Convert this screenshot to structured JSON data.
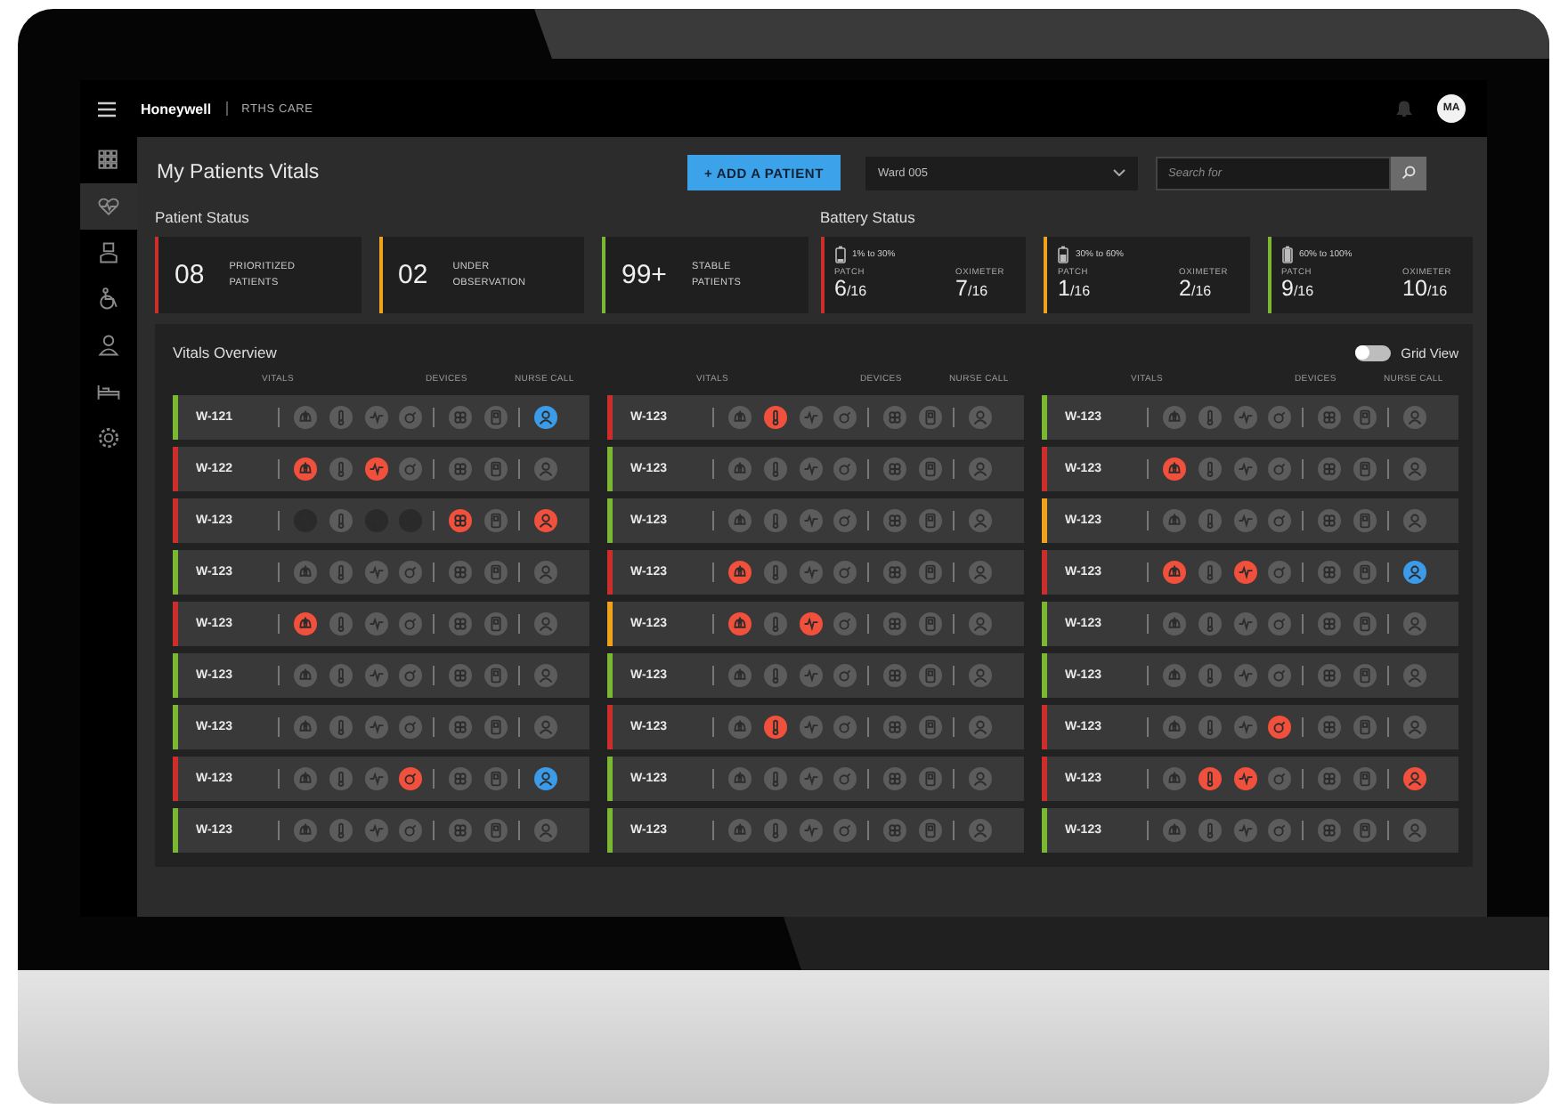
{
  "topbar": {
    "brand": "Honeywell",
    "product": "RTHS CARE",
    "avatar": "MA"
  },
  "sidebar": {
    "items": [
      {
        "kind": "grid",
        "selected": false
      },
      {
        "kind": "heart",
        "selected": true
      },
      {
        "kind": "nurse",
        "selected": false
      },
      {
        "kind": "wheelchair",
        "selected": false
      },
      {
        "kind": "doctor",
        "selected": false
      },
      {
        "kind": "bed",
        "selected": false
      },
      {
        "kind": "settings",
        "selected": false
      }
    ]
  },
  "page_title": "My Patients Vitals",
  "add_button": "+ ADD A PATIENT",
  "ward_select": {
    "value": "Ward 005"
  },
  "search": {
    "placeholder": "Search for"
  },
  "patient_status": {
    "title": "Patient Status",
    "cards": [
      {
        "count": "08",
        "label": "PRIORITIZED PATIENTS",
        "color": "#cc2e2b"
      },
      {
        "count": "02",
        "label": "UNDER OBSERVATION",
        "color": "#f0a21c"
      },
      {
        "count": "99+",
        "label": "STABLE PATIENTS",
        "color": "#7ab733"
      }
    ]
  },
  "battery_status": {
    "title": "Battery Status",
    "cards": [
      {
        "kind": "low",
        "range": "1% to 30%",
        "color": "#cc2e2b",
        "patch_label": "PATCH",
        "patch": "6",
        "patch_total": "/16",
        "oximeter_label": "OXIMETER",
        "oximeter": "7",
        "oximeter_total": "/16"
      },
      {
        "kind": "mid",
        "range": "30% to 60%",
        "color": "#f0a21c",
        "patch_label": "PATCH",
        "patch": "1",
        "patch_total": "/16",
        "oximeter_label": "OXIMETER",
        "oximeter": "2",
        "oximeter_total": "/16"
      },
      {
        "kind": "high",
        "range": "60% to 100%",
        "color": "#7ab733",
        "patch_label": "PATCH",
        "patch": "9",
        "patch_total": "/16",
        "oximeter_label": "OXIMETER",
        "oximeter": "10",
        "oximeter_total": "/16"
      }
    ]
  },
  "overview": {
    "title": "Vitals Overview",
    "grid_view": {
      "label": "Grid View",
      "on": false
    },
    "columns": [
      {
        "headers": [
          "VITALS",
          "DEVICES",
          "NURSE CALL"
        ],
        "rows": [
          {
            "ward": "W-121",
            "color": "#7ab733",
            "vitals": [
              {
                "color": "#5c5c5c"
              },
              {
                "color": "#5c5c5c"
              },
              {
                "color": "#5c5c5c"
              },
              {
                "color": "#5c5c5c"
              }
            ],
            "devices": [
              {
                "color": "#5c5c5c"
              },
              {
                "color": "#5c5c5c"
              }
            ],
            "nurse_call": {
              "color": "#3c9be8"
            }
          },
          {
            "ward": "W-122",
            "color": "#cc2e2b",
            "vitals": [
              {
                "color": "#f0503c"
              },
              {
                "color": "#5c5c5c"
              },
              {
                "color": "#f0503c"
              },
              {
                "color": "#5c5c5c"
              }
            ],
            "devices": [
              {
                "color": "#5c5c5c"
              },
              {
                "color": "#5c5c5c"
              }
            ],
            "nurse_call": {
              "color": "#5c5c5c"
            }
          },
          {
            "ward": "W-123",
            "color": "#cc2e2b",
            "vitals": [
              {
                "color": "#2a2a2a"
              },
              {
                "color": "#5c5c5c"
              },
              {
                "color": "#2a2a2a"
              },
              {
                "color": "#2a2a2a"
              }
            ],
            "devices": [
              {
                "color": "#f0503c"
              },
              {
                "color": "#5c5c5c"
              }
            ],
            "nurse_call": {
              "color": "#f0503c"
            }
          },
          {
            "ward": "W-123",
            "color": "#7ab733",
            "vitals": [
              {
                "color": "#5c5c5c"
              },
              {
                "color": "#5c5c5c"
              },
              {
                "color": "#5c5c5c"
              },
              {
                "color": "#5c5c5c"
              }
            ],
            "devices": [
              {
                "color": "#5c5c5c"
              },
              {
                "color": "#5c5c5c"
              }
            ],
            "nurse_call": {
              "color": "#5c5c5c"
            }
          },
          {
            "ward": "W-123",
            "color": "#cc2e2b",
            "vitals": [
              {
                "color": "#f0503c"
              },
              {
                "color": "#5c5c5c"
              },
              {
                "color": "#5c5c5c"
              },
              {
                "color": "#5c5c5c"
              }
            ],
            "devices": [
              {
                "color": "#5c5c5c"
              },
              {
                "color": "#5c5c5c"
              }
            ],
            "nurse_call": {
              "color": "#5c5c5c"
            }
          },
          {
            "ward": "W-123",
            "color": "#7ab733",
            "vitals": [
              {
                "color": "#5c5c5c"
              },
              {
                "color": "#5c5c5c"
              },
              {
                "color": "#5c5c5c"
              },
              {
                "color": "#5c5c5c"
              }
            ],
            "devices": [
              {
                "color": "#5c5c5c"
              },
              {
                "color": "#5c5c5c"
              }
            ],
            "nurse_call": {
              "color": "#5c5c5c"
            }
          },
          {
            "ward": "W-123",
            "color": "#7ab733",
            "vitals": [
              {
                "color": "#5c5c5c"
              },
              {
                "color": "#5c5c5c"
              },
              {
                "color": "#5c5c5c"
              },
              {
                "color": "#5c5c5c"
              }
            ],
            "devices": [
              {
                "color": "#5c5c5c"
              },
              {
                "color": "#5c5c5c"
              }
            ],
            "nurse_call": {
              "color": "#5c5c5c"
            }
          },
          {
            "ward": "W-123",
            "color": "#cc2e2b",
            "vitals": [
              {
                "color": "#5c5c5c"
              },
              {
                "color": "#5c5c5c"
              },
              {
                "color": "#5c5c5c"
              },
              {
                "color": "#f0503c"
              }
            ],
            "devices": [
              {
                "color": "#5c5c5c"
              },
              {
                "color": "#5c5c5c"
              }
            ],
            "nurse_call": {
              "color": "#3c9be8"
            }
          },
          {
            "ward": "W-123",
            "color": "#7ab733",
            "vitals": [
              {
                "color": "#5c5c5c"
              },
              {
                "color": "#5c5c5c"
              },
              {
                "color": "#5c5c5c"
              },
              {
                "color": "#5c5c5c"
              }
            ],
            "devices": [
              {
                "color": "#5c5c5c"
              },
              {
                "color": "#5c5c5c"
              }
            ],
            "nurse_call": {
              "color": "#5c5c5c"
            }
          }
        ]
      },
      {
        "headers": [
          "VITALS",
          "DEVICES",
          "NURSE CALL"
        ],
        "rows": [
          {
            "ward": "W-123",
            "color": "#cc2e2b",
            "vitals": [
              {
                "color": "#5c5c5c"
              },
              {
                "color": "#f0503c"
              },
              {
                "color": "#5c5c5c"
              },
              {
                "color": "#5c5c5c"
              }
            ],
            "devices": [
              {
                "color": "#5c5c5c"
              },
              {
                "color": "#5c5c5c"
              }
            ],
            "nurse_call": {
              "color": "#5c5c5c"
            }
          },
          {
            "ward": "W-123",
            "color": "#7ab733",
            "vitals": [
              {
                "color": "#5c5c5c"
              },
              {
                "color": "#5c5c5c"
              },
              {
                "color": "#5c5c5c"
              },
              {
                "color": "#5c5c5c"
              }
            ],
            "devices": [
              {
                "color": "#5c5c5c"
              },
              {
                "color": "#5c5c5c"
              }
            ],
            "nurse_call": {
              "color": "#5c5c5c"
            }
          },
          {
            "ward": "W-123",
            "color": "#7ab733",
            "vitals": [
              {
                "color": "#5c5c5c"
              },
              {
                "color": "#5c5c5c"
              },
              {
                "color": "#5c5c5c"
              },
              {
                "color": "#5c5c5c"
              }
            ],
            "devices": [
              {
                "color": "#5c5c5c"
              },
              {
                "color": "#5c5c5c"
              }
            ],
            "nurse_call": {
              "color": "#5c5c5c"
            }
          },
          {
            "ward": "W-123",
            "color": "#cc2e2b",
            "vitals": [
              {
                "color": "#f0503c"
              },
              {
                "color": "#5c5c5c"
              },
              {
                "color": "#5c5c5c"
              },
              {
                "color": "#5c5c5c"
              }
            ],
            "devices": [
              {
                "color": "#5c5c5c"
              },
              {
                "color": "#5c5c5c"
              }
            ],
            "nurse_call": {
              "color": "#5c5c5c"
            }
          },
          {
            "ward": "W-123",
            "color": "#f0a21c",
            "vitals": [
              {
                "color": "#f0503c"
              },
              {
                "color": "#5c5c5c"
              },
              {
                "color": "#f0503c"
              },
              {
                "color": "#5c5c5c"
              }
            ],
            "devices": [
              {
                "color": "#5c5c5c"
              },
              {
                "color": "#5c5c5c"
              }
            ],
            "nurse_call": {
              "color": "#5c5c5c"
            }
          },
          {
            "ward": "W-123",
            "color": "#7ab733",
            "vitals": [
              {
                "color": "#5c5c5c"
              },
              {
                "color": "#5c5c5c"
              },
              {
                "color": "#5c5c5c"
              },
              {
                "color": "#5c5c5c"
              }
            ],
            "devices": [
              {
                "color": "#5c5c5c"
              },
              {
                "color": "#5c5c5c"
              }
            ],
            "nurse_call": {
              "color": "#5c5c5c"
            }
          },
          {
            "ward": "W-123",
            "color": "#cc2e2b",
            "vitals": [
              {
                "color": "#5c5c5c"
              },
              {
                "color": "#f0503c"
              },
              {
                "color": "#5c5c5c"
              },
              {
                "color": "#5c5c5c"
              }
            ],
            "devices": [
              {
                "color": "#5c5c5c"
              },
              {
                "color": "#5c5c5c"
              }
            ],
            "nurse_call": {
              "color": "#5c5c5c"
            }
          },
          {
            "ward": "W-123",
            "color": "#7ab733",
            "vitals": [
              {
                "color": "#5c5c5c"
              },
              {
                "color": "#5c5c5c"
              },
              {
                "color": "#5c5c5c"
              },
              {
                "color": "#5c5c5c"
              }
            ],
            "devices": [
              {
                "color": "#5c5c5c"
              },
              {
                "color": "#5c5c5c"
              }
            ],
            "nurse_call": {
              "color": "#5c5c5c"
            }
          },
          {
            "ward": "W-123",
            "color": "#7ab733",
            "vitals": [
              {
                "color": "#5c5c5c"
              },
              {
                "color": "#5c5c5c"
              },
              {
                "color": "#5c5c5c"
              },
              {
                "color": "#5c5c5c"
              }
            ],
            "devices": [
              {
                "color": "#5c5c5c"
              },
              {
                "color": "#5c5c5c"
              }
            ],
            "nurse_call": {
              "color": "#5c5c5c"
            }
          }
        ]
      },
      {
        "headers": [
          "VITALS",
          "DEVICES",
          "NURSE CALL"
        ],
        "rows": [
          {
            "ward": "W-123",
            "color": "#7ab733",
            "vitals": [
              {
                "color": "#5c5c5c"
              },
              {
                "color": "#5c5c5c"
              },
              {
                "color": "#5c5c5c"
              },
              {
                "color": "#5c5c5c"
              }
            ],
            "devices": [
              {
                "color": "#5c5c5c"
              },
              {
                "color": "#5c5c5c"
              }
            ],
            "nurse_call": {
              "color": "#5c5c5c"
            }
          },
          {
            "ward": "W-123",
            "color": "#cc2e2b",
            "vitals": [
              {
                "color": "#f0503c"
              },
              {
                "color": "#5c5c5c"
              },
              {
                "color": "#5c5c5c"
              },
              {
                "color": "#5c5c5c"
              }
            ],
            "devices": [
              {
                "color": "#5c5c5c"
              },
              {
                "color": "#5c5c5c"
              }
            ],
            "nurse_call": {
              "color": "#5c5c5c"
            }
          },
          {
            "ward": "W-123",
            "color": "#f0a21c",
            "vitals": [
              {
                "color": "#5c5c5c"
              },
              {
                "color": "#5c5c5c"
              },
              {
                "color": "#5c5c5c"
              },
              {
                "color": "#5c5c5c"
              }
            ],
            "devices": [
              {
                "color": "#5c5c5c"
              },
              {
                "color": "#5c5c5c"
              }
            ],
            "nurse_call": {
              "color": "#5c5c5c"
            }
          },
          {
            "ward": "W-123",
            "color": "#cc2e2b",
            "vitals": [
              {
                "color": "#f0503c"
              },
              {
                "color": "#5c5c5c"
              },
              {
                "color": "#f0503c"
              },
              {
                "color": "#5c5c5c"
              }
            ],
            "devices": [
              {
                "color": "#5c5c5c"
              },
              {
                "color": "#5c5c5c"
              }
            ],
            "nurse_call": {
              "color": "#3c9be8"
            }
          },
          {
            "ward": "W-123",
            "color": "#7ab733",
            "vitals": [
              {
                "color": "#5c5c5c"
              },
              {
                "color": "#5c5c5c"
              },
              {
                "color": "#5c5c5c"
              },
              {
                "color": "#5c5c5c"
              }
            ],
            "devices": [
              {
                "color": "#5c5c5c"
              },
              {
                "color": "#5c5c5c"
              }
            ],
            "nurse_call": {
              "color": "#5c5c5c"
            }
          },
          {
            "ward": "W-123",
            "color": "#7ab733",
            "vitals": [
              {
                "color": "#5c5c5c"
              },
              {
                "color": "#5c5c5c"
              },
              {
                "color": "#5c5c5c"
              },
              {
                "color": "#5c5c5c"
              }
            ],
            "devices": [
              {
                "color": "#5c5c5c"
              },
              {
                "color": "#5c5c5c"
              }
            ],
            "nurse_call": {
              "color": "#5c5c5c"
            }
          },
          {
            "ward": "W-123",
            "color": "#cc2e2b",
            "vitals": [
              {
                "color": "#5c5c5c"
              },
              {
                "color": "#5c5c5c"
              },
              {
                "color": "#5c5c5c"
              },
              {
                "color": "#f0503c"
              }
            ],
            "devices": [
              {
                "color": "#5c5c5c"
              },
              {
                "color": "#5c5c5c"
              }
            ],
            "nurse_call": {
              "color": "#5c5c5c"
            }
          },
          {
            "ward": "W-123",
            "color": "#cc2e2b",
            "vitals": [
              {
                "color": "#5c5c5c"
              },
              {
                "color": "#f0503c"
              },
              {
                "color": "#f0503c"
              },
              {
                "color": "#5c5c5c"
              }
            ],
            "devices": [
              {
                "color": "#5c5c5c"
              },
              {
                "color": "#5c5c5c"
              }
            ],
            "nurse_call": {
              "color": "#f0503c"
            }
          },
          {
            "ward": "W-123",
            "color": "#7ab733",
            "vitals": [
              {
                "color": "#5c5c5c"
              },
              {
                "color": "#5c5c5c"
              },
              {
                "color": "#5c5c5c"
              },
              {
                "color": "#5c5c5c"
              }
            ],
            "devices": [
              {
                "color": "#5c5c5c"
              },
              {
                "color": "#5c5c5c"
              }
            ],
            "nurse_call": {
              "color": "#5c5c5c"
            }
          }
        ]
      }
    ]
  }
}
